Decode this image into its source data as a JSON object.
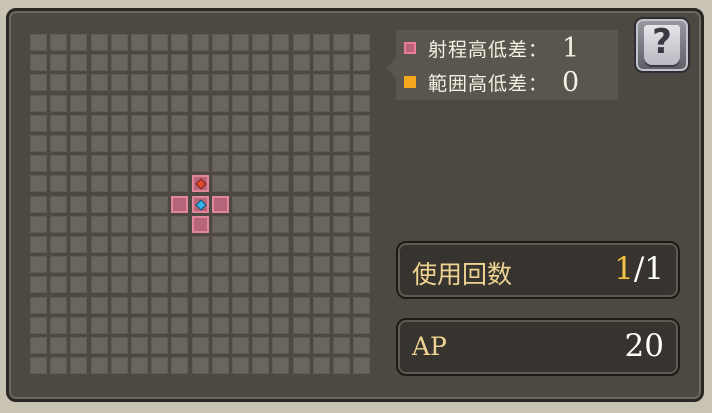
{
  "grid": {
    "columns": 17,
    "rows": 17,
    "range_cells": [
      {
        "col": 8,
        "row": 7,
        "marker": "red-diamond"
      },
      {
        "col": 7,
        "row": 8,
        "marker": ""
      },
      {
        "col": 8,
        "row": 8,
        "marker": "blue-diamond"
      },
      {
        "col": 9,
        "row": 8,
        "marker": ""
      },
      {
        "col": 8,
        "row": 9,
        "marker": ""
      }
    ],
    "colors": {
      "cell": "#6b665d",
      "range": "#b5647a",
      "range_border": "#e2869c"
    }
  },
  "legend": {
    "range_height": {
      "label": "射程高低差：",
      "value": "1",
      "swatch_color": "#ea7d97"
    },
    "area_height": {
      "label": "範囲高低差：",
      "value": "0",
      "swatch_color": "#f3a71e"
    }
  },
  "help_button": {
    "glyph": "?",
    "icon": "question-book-icon"
  },
  "uses": {
    "label": "使用回数",
    "current": "1",
    "separator": "/",
    "max": "1"
  },
  "ap": {
    "label": "AP",
    "value": "20"
  }
}
